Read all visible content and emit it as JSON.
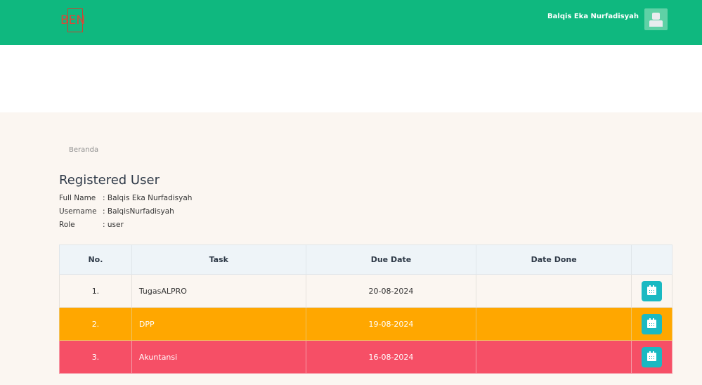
{
  "header": {
    "logo": "BEN",
    "user_name": "Balqis Eka Nurfadisyah",
    "avatar_icon": "user-avatar-icon",
    "bg_color": "#0fb87f"
  },
  "breadcrumb": "Beranda",
  "page_title": "Registered User",
  "profile": {
    "full_name_label": "Full Name",
    "full_name_value": ": Balqis Eka Nurfadisyah",
    "username_label": "Username",
    "username_value": ": BalqisNurfadisyah",
    "role_label": "Role",
    "role_value": ": user"
  },
  "table": {
    "headers": [
      "No.",
      "Task",
      "Due Date",
      "Date Done",
      ""
    ],
    "rows": [
      {
        "no": "1.",
        "task": "TugasALPRO",
        "due": "20-08-2024",
        "done": "",
        "status_color": "#fbf6f1",
        "action_icon": "calendar-icon"
      },
      {
        "no": "2.",
        "task": "DPP",
        "due": "19-08-2024",
        "done": "",
        "status_color": "#ffa700",
        "action_icon": "calendar-icon"
      },
      {
        "no": "3.",
        "task": "Akuntansi",
        "due": "16-08-2024",
        "done": "",
        "status_color": "#f64f66",
        "action_icon": "calendar-icon"
      }
    ]
  }
}
